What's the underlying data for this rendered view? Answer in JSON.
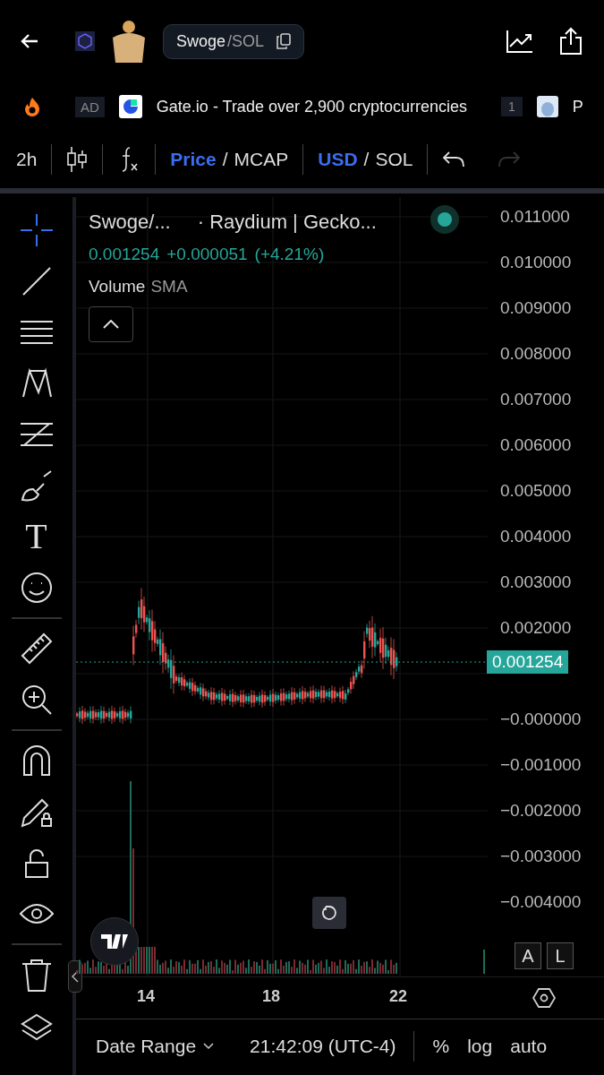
{
  "header": {
    "pair_base": "Swoge",
    "pair_quote": "/SOL"
  },
  "ad_bar": {
    "badge": "AD",
    "text": "Gate.io - Trade over 2,900 cryptocurrencies",
    "count": "1",
    "next": "P"
  },
  "toolbar": {
    "interval": "2h",
    "price_mode_separator": "/",
    "currency_separator": "/",
    "price_mode": [
      {
        "label": "Price",
        "selected": true
      },
      {
        "label": "MCAP",
        "selected": false
      }
    ],
    "currency": [
      {
        "label": "USD",
        "selected": true
      },
      {
        "label": "SOL",
        "selected": false
      }
    ]
  },
  "tools": [
    {
      "kind": "crosshair",
      "selected": true
    },
    {
      "kind": "line",
      "selected": false
    },
    {
      "kind": "hlines",
      "selected": false
    },
    {
      "kind": "pattern",
      "selected": false
    },
    {
      "kind": "fib",
      "selected": false
    },
    {
      "kind": "brush",
      "selected": false
    },
    {
      "kind": "text",
      "label": "T",
      "selected": false
    },
    {
      "kind": "emoji",
      "selected": false
    },
    {
      "kind": "divider"
    },
    {
      "kind": "ruler",
      "selected": false
    },
    {
      "kind": "zoom",
      "selected": false
    },
    {
      "kind": "divider"
    },
    {
      "kind": "magnet",
      "selected": false
    },
    {
      "kind": "pencil-lock",
      "selected": false
    },
    {
      "kind": "unlock",
      "selected": false
    },
    {
      "kind": "eye",
      "selected": false
    },
    {
      "kind": "divider"
    },
    {
      "kind": "trash",
      "selected": false
    },
    {
      "kind": "layers",
      "selected": false
    }
  ],
  "legend": {
    "title": "Swoge/...",
    "source": "· Raydium | Gecko...",
    "price": "0.001254",
    "change": "+0.000051",
    "change_pct": "(+4.21%)",
    "indicator": "Volume",
    "indicator_type": "SMA"
  },
  "y_axis": [
    "0.011000",
    "0.010000",
    "0.009000",
    "0.008000",
    "0.007000",
    "0.006000",
    "0.005000",
    "0.004000",
    "0.003000",
    "0.002000",
    "−0.000000",
    "−0.001000",
    "−0.002000",
    "−0.003000",
    "−0.004000"
  ],
  "price_label": "0.001254",
  "scale_buttons": [
    "A",
    "L"
  ],
  "x_axis": [
    "14",
    "18",
    "22"
  ],
  "bottom_bar": {
    "date_range": "Date Range",
    "time": "21:42:09 (UTC-4)",
    "percent": "%",
    "log": "log",
    "auto": "auto"
  }
}
